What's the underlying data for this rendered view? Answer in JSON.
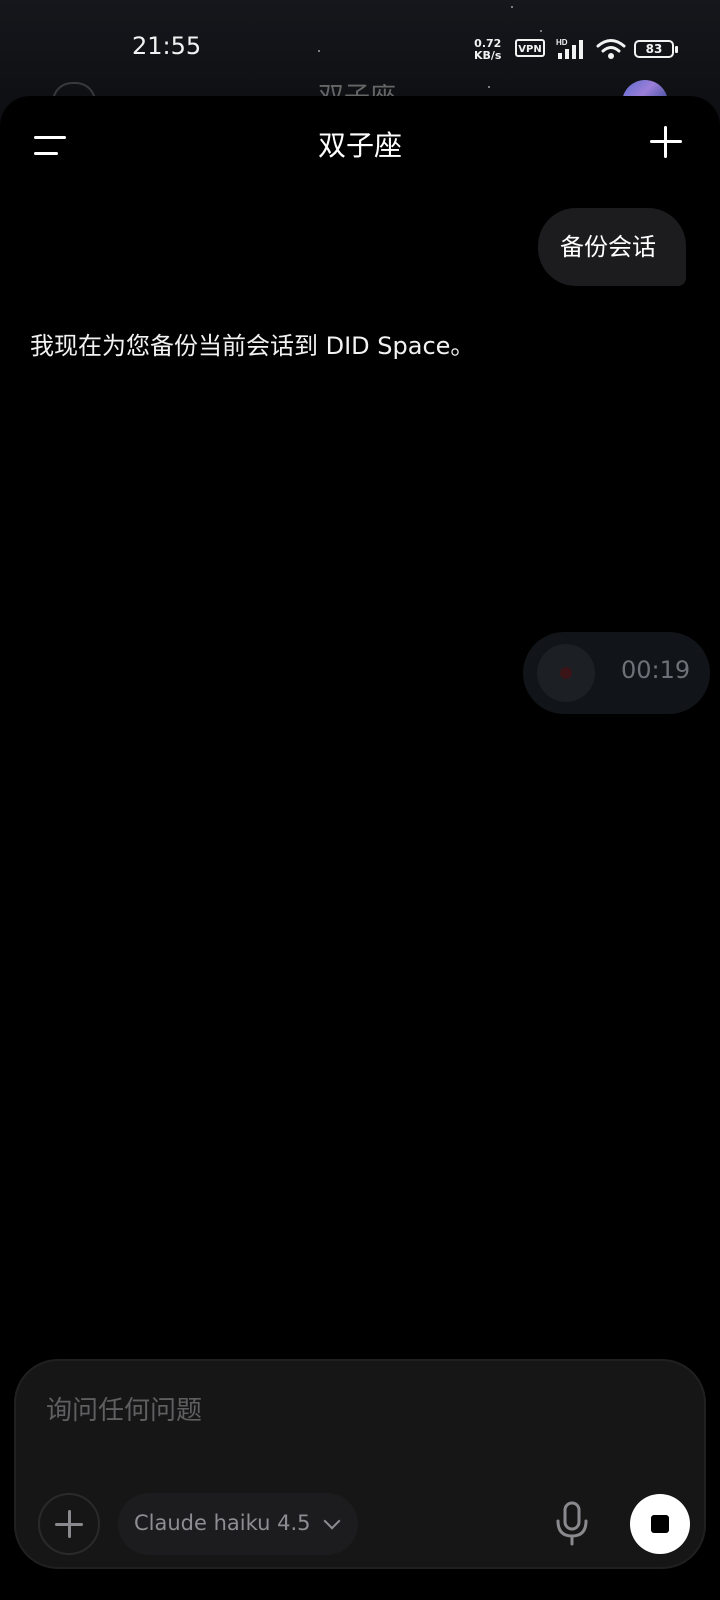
{
  "status_bar": {
    "time": "21:55",
    "net_speed_value": "0.72",
    "net_speed_unit": "KB/s",
    "vpn": "VPN",
    "hd": "HD",
    "battery": "83",
    "icons": [
      "signal-icon",
      "wifi-icon",
      "battery-icon"
    ]
  },
  "header": {
    "title": "双子座",
    "menu_icon": "menu-icon",
    "new_chat_icon": "plus-icon"
  },
  "background_app": {
    "title": "双子座"
  },
  "messages": {
    "user_text": "备份会话",
    "assistant_text": "我现在为您备份当前会话到 DID Space。",
    "voice_duration": "00:19"
  },
  "composer": {
    "placeholder": "询问任何问题",
    "model": "Claude haiku 4.5",
    "icons": [
      "plus-icon",
      "chevron-down-icon",
      "microphone-icon",
      "stop-icon"
    ]
  },
  "colors": {
    "background": "#000000",
    "bubble": "#1c1c1e",
    "composer": "#161616",
    "muted_text": "#8e8e92"
  }
}
